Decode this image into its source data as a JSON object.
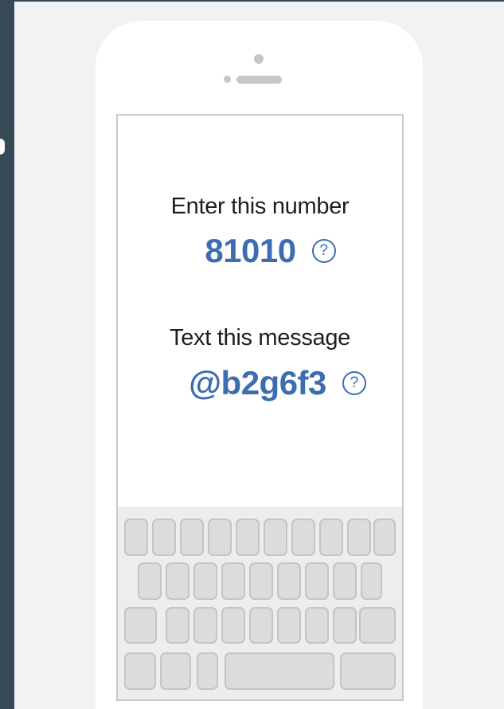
{
  "instructions": {
    "number_label": "Enter this number",
    "number_value": "81010",
    "message_label": "Text this message",
    "message_value": "@b2g6f3"
  },
  "icons": {
    "help": "question-mark-circle-icon",
    "help_glyph": "?"
  },
  "colors": {
    "accent": "#3c6db3",
    "sidebar": "#354a54",
    "background": "#f1f2f4"
  }
}
